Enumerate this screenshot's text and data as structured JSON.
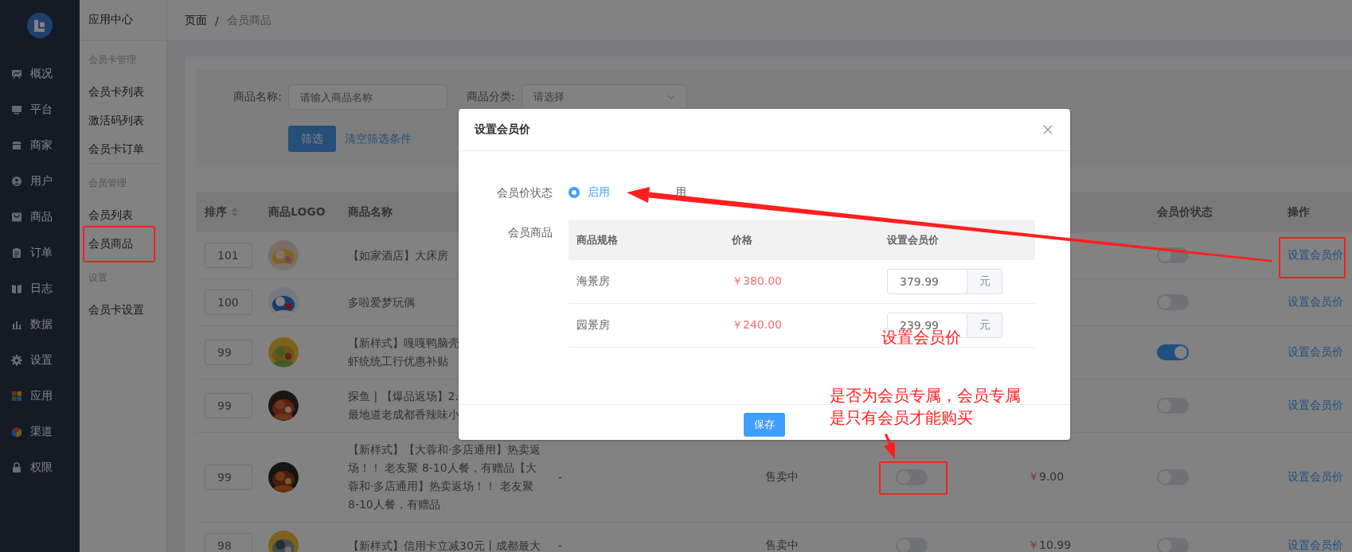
{
  "nav": {
    "items": [
      {
        "label": "概况"
      },
      {
        "label": "平台"
      },
      {
        "label": "商家"
      },
      {
        "label": "用户"
      },
      {
        "label": "商品"
      },
      {
        "label": "订单"
      },
      {
        "label": "日志"
      },
      {
        "label": "数据"
      },
      {
        "label": "设置"
      },
      {
        "label": "应用"
      },
      {
        "label": "渠道"
      },
      {
        "label": "权限"
      }
    ]
  },
  "subnav": {
    "title": "应用中心",
    "groups": [
      {
        "label": "会员卡管理",
        "items": [
          "会员卡列表",
          "激活码列表",
          "会员卡订单"
        ]
      },
      {
        "label": "会员管理",
        "items": [
          "会员列表",
          "会员商品"
        ]
      },
      {
        "label": "设置",
        "items": [
          "会员卡设置"
        ]
      }
    ]
  },
  "breadcrumb": {
    "items": [
      "页面",
      "会员商品"
    ],
    "separator": "/"
  },
  "filter": {
    "fields": [
      {
        "kind": "input",
        "label": "商品名称:",
        "placeholder": "请输入商品名称"
      },
      {
        "kind": "select",
        "label": "商品分类:",
        "placeholder": "请选择"
      }
    ],
    "buttons": [
      {
        "kind": "primary",
        "label": "筛选"
      },
      {
        "kind": "link",
        "label": "清空筛选条件"
      }
    ]
  },
  "table": {
    "header": {
      "sort": "排序",
      "logo": "商品LOGO",
      "name": "商品名称",
      "member_price_status": "会员价状态",
      "action": "操作"
    },
    "rows": [
      {
        "sort": "101",
        "name": "【如家酒店】大床房",
        "member_price_on": false,
        "action": "设置会员价"
      },
      {
        "sort": "100",
        "name": "多啦爱梦玩偶",
        "member_price_on": false,
        "action": "设置会员价"
      },
      {
        "sort": "99",
        "name": [
          "【新样式】嘎嘎鸭脑壳",
          "虾统统工行优惠补贴"
        ],
        "member_price_on": true,
        "action": "设置会员价"
      },
      {
        "sort": "99",
        "name": [
          "探鱼 | 【爆品返场】2.",
          "最地道老成都香辣味小"
        ],
        "member_price_on": false,
        "action": "设置会员价"
      },
      {
        "sort": "99",
        "name": "【新样式】【大蓉和·多店通用】热卖返场！！ 老友聚 8-10人餐，有赠品【大蓉和·多店通用】热卖返场！！ 老友聚 8-10人餐，有赠品",
        "column_4": "-",
        "sale_status": "售卖中",
        "members_only": false,
        "currency": "￥",
        "price": "9.00",
        "member_price_on": false,
        "action": "设置会员价"
      },
      {
        "sort": "98",
        "name": "【新样式】信用卡立减30元丨成都最大",
        "column_4": "-",
        "sale_status": "售卖中",
        "members_only": false,
        "currency": "￥",
        "price": "10.99",
        "member_price_on": false,
        "action": "设置会员价"
      }
    ]
  },
  "modal": {
    "title": "设置会员价",
    "status_label": "会员价状态",
    "status_options": [
      {
        "label": "启用",
        "selected": true
      },
      {
        "label": "用",
        "selected": false
      }
    ],
    "goods_label": "会员商品",
    "columns": [
      "商品规格",
      "价格",
      "设置会员价"
    ],
    "rows": [
      {
        "spec": "海景房",
        "price": "￥380.00",
        "member_price": "379.99",
        "unit": "元"
      },
      {
        "spec": "园景房",
        "price": "￥240.00",
        "member_price": "239.99",
        "unit": "元"
      }
    ],
    "save": "保存"
  },
  "annotations": [
    {
      "text": "设置会员价"
    },
    {
      "text": "是否为会员专属，会员专属是只有会员才能购买"
    }
  ]
}
